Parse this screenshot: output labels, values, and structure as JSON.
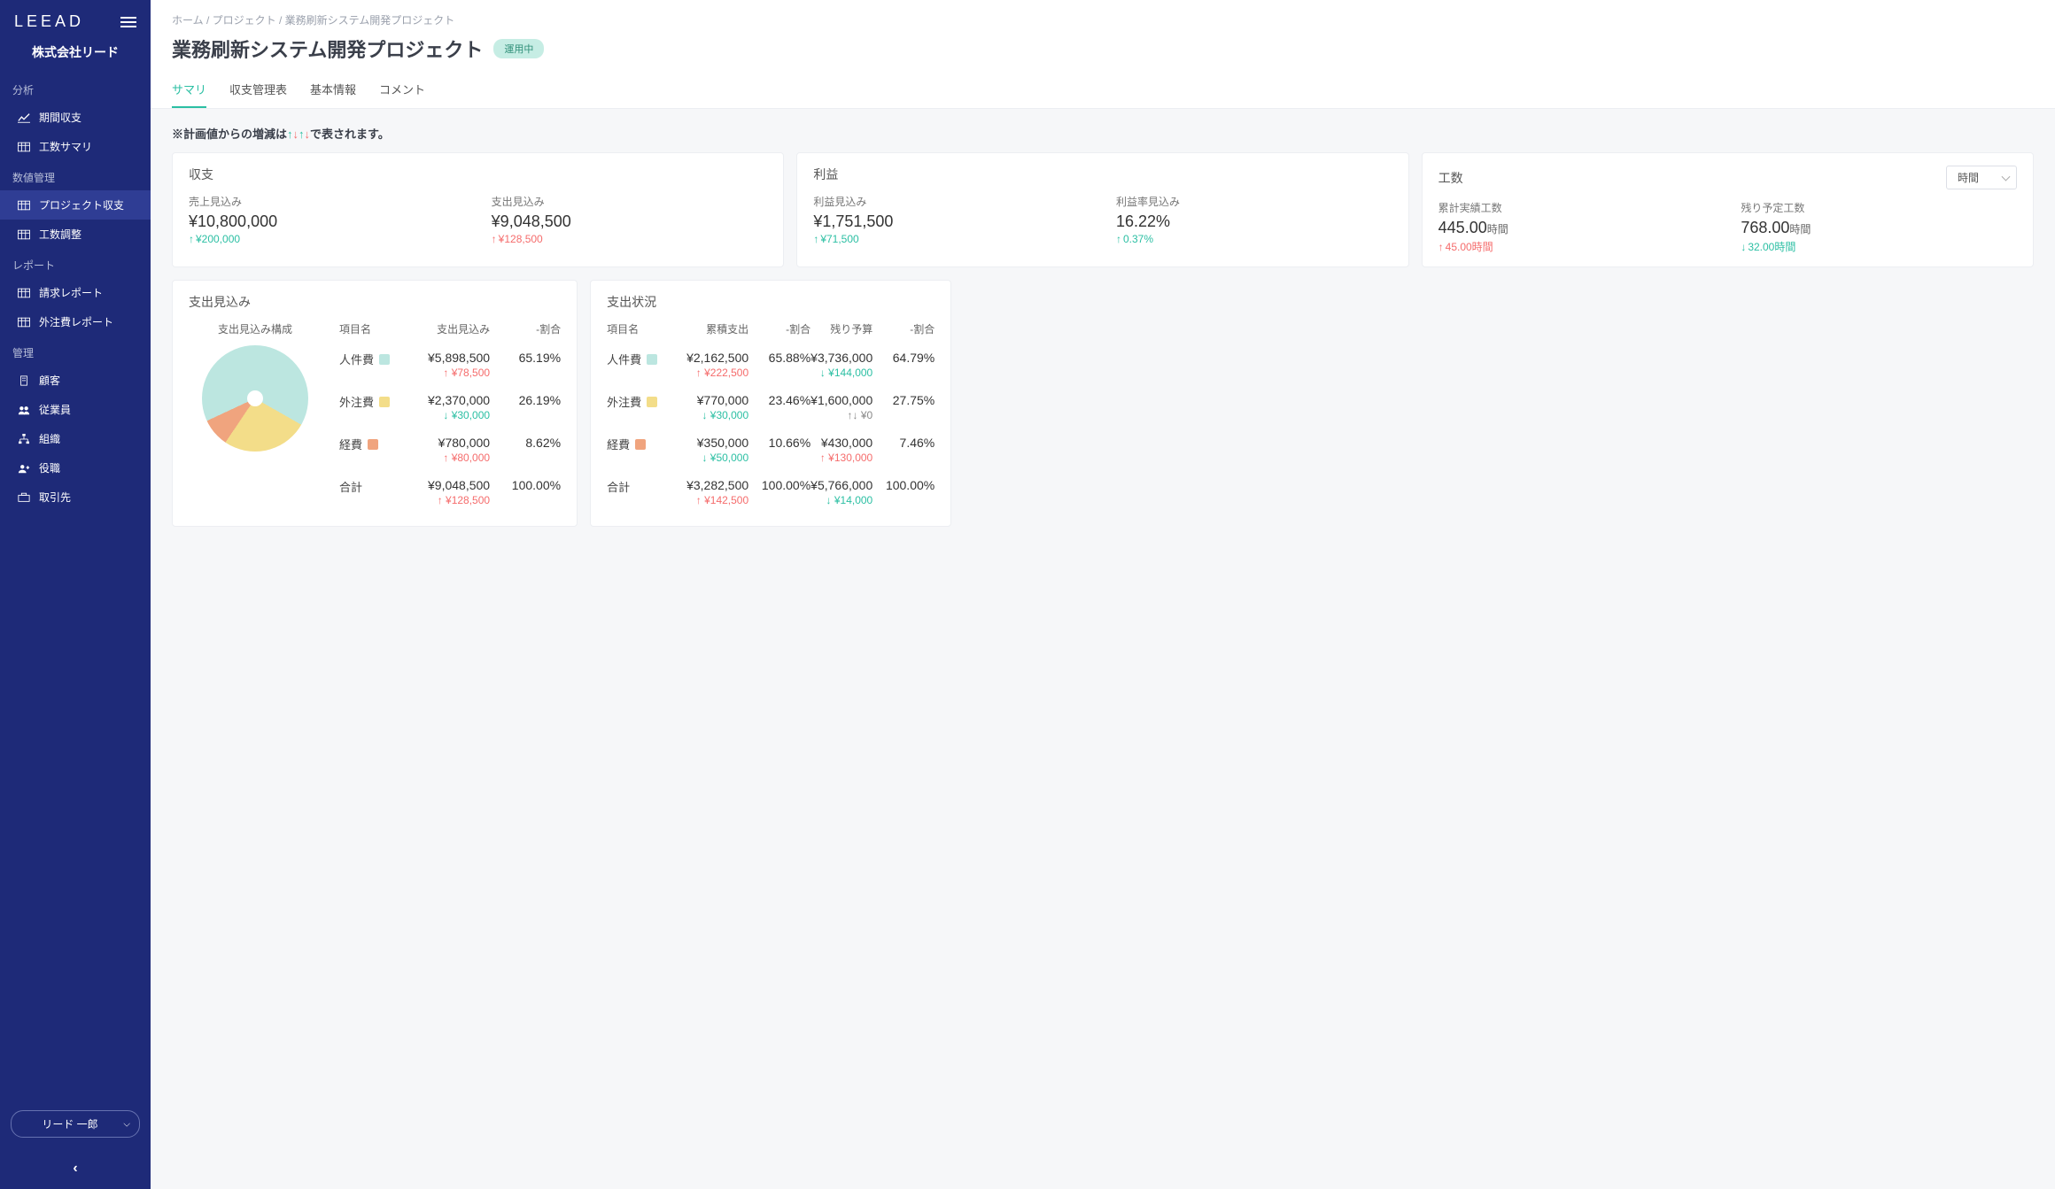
{
  "brand": "LEEAD",
  "company_name": "株式会社リード",
  "sidebar": {
    "sections": [
      {
        "title": "分析",
        "items": [
          {
            "icon": "chart-line",
            "label": "期間収支"
          },
          {
            "icon": "table",
            "label": "工数サマリ"
          }
        ]
      },
      {
        "title": "数値管理",
        "items": [
          {
            "icon": "table",
            "label": "プロジェクト収支",
            "active": true
          },
          {
            "icon": "table",
            "label": "工数調整"
          }
        ]
      },
      {
        "title": "レポート",
        "items": [
          {
            "icon": "table",
            "label": "請求レポート"
          },
          {
            "icon": "table",
            "label": "外注費レポート"
          }
        ]
      },
      {
        "title": "管理",
        "items": [
          {
            "icon": "building",
            "label": "顧客"
          },
          {
            "icon": "users",
            "label": "従業員"
          },
          {
            "icon": "sitemap",
            "label": "組織"
          },
          {
            "icon": "user-plus",
            "label": "役職"
          },
          {
            "icon": "briefcase",
            "label": "取引先"
          }
        ]
      }
    ],
    "user_label": "リード 一郎"
  },
  "breadcrumb": "ホーム / プロジェクト / 業務刷新システム開発プロジェクト",
  "page_title": "業務刷新システム開発プロジェクト",
  "status_badge": "運用中",
  "tabs": [
    "サマリ",
    "収支管理表",
    "基本情報",
    "コメント"
  ],
  "active_tab": 0,
  "note_prefix": "※計画値からの増減は",
  "note_suffix": "で表されます。",
  "summary_cards": {
    "shuushi": {
      "title": "収支",
      "metrics": [
        {
          "label": "売上見込み",
          "value": "¥10,800,000",
          "delta": "¥200,000",
          "dir": "up-good"
        },
        {
          "label": "支出見込み",
          "value": "¥9,048,500",
          "delta": "¥128,500",
          "dir": "up-bad"
        }
      ]
    },
    "rieki": {
      "title": "利益",
      "metrics": [
        {
          "label": "利益見込み",
          "value": "¥1,751,500",
          "delta": "¥71,500",
          "dir": "up-good"
        },
        {
          "label": "利益率見込み",
          "value": "16.22%",
          "delta": "0.37%",
          "dir": "up-good"
        }
      ]
    },
    "kousuu": {
      "title": "工数",
      "select": "時間",
      "metrics": [
        {
          "label": "累計実績工数",
          "value": "445.00",
          "unit": "時間",
          "delta": "45.00時間",
          "dir": "up-bad"
        },
        {
          "label": "残り予定工数",
          "value": "768.00",
          "unit": "時間",
          "delta": "32.00時間",
          "dir": "down-good"
        }
      ]
    }
  },
  "spending_forecast": {
    "title": "支出見込み",
    "pie_title": "支出見込み構成",
    "headers": {
      "name": "項目名",
      "value": "支出見込み",
      "pct": "-割合"
    },
    "rows": [
      {
        "name": "人件費",
        "color": "#bce6e0",
        "value": "¥5,898,500",
        "pct": "65.19%",
        "delta": "¥78,500",
        "dir": "up-bad"
      },
      {
        "name": "外注費",
        "color": "#f3dd89",
        "value": "¥2,370,000",
        "pct": "26.19%",
        "delta": "¥30,000",
        "dir": "down-good"
      },
      {
        "name": "経費",
        "color": "#f0a47e",
        "value": "¥780,000",
        "pct": "8.62%",
        "delta": "¥80,000",
        "dir": "up-bad"
      },
      {
        "name": "合計",
        "color": "",
        "value": "¥9,048,500",
        "pct": "100.00%",
        "delta": "¥128,500",
        "dir": "up-bad"
      }
    ]
  },
  "spending_status": {
    "title": "支出状況",
    "headers": {
      "name": "項目名",
      "cum": "累積支出",
      "cpct": "-割合",
      "rem": "残り予算",
      "rpct": "-割合"
    },
    "rows": [
      {
        "name": "人件費",
        "color": "#bce6e0",
        "cum": "¥2,162,500",
        "cpct": "65.88%",
        "cum_delta": "¥222,500",
        "cum_dir": "up-bad",
        "rem": "¥3,736,000",
        "rpct": "64.79%",
        "rem_delta": "¥144,000",
        "rem_dir": "down-good"
      },
      {
        "name": "外注費",
        "color": "#f3dd89",
        "cum": "¥770,000",
        "cpct": "23.46%",
        "cum_delta": "¥30,000",
        "cum_dir": "down-good",
        "rem": "¥1,600,000",
        "rpct": "27.75%",
        "rem_delta": "¥0",
        "rem_dir": "both"
      },
      {
        "name": "経費",
        "color": "#f0a47e",
        "cum": "¥350,000",
        "cpct": "10.66%",
        "cum_delta": "¥50,000",
        "cum_dir": "down-good",
        "rem": "¥430,000",
        "rpct": "7.46%",
        "rem_delta": "¥130,000",
        "rem_dir": "up-bad"
      },
      {
        "name": "合計",
        "color": "",
        "cum": "¥3,282,500",
        "cpct": "100.00%",
        "cum_delta": "¥142,500",
        "cum_dir": "up-bad",
        "rem": "¥5,766,000",
        "rpct": "100.00%",
        "rem_delta": "¥14,000",
        "rem_dir": "down-good"
      }
    ]
  },
  "chart_data": {
    "type": "pie",
    "title": "支出見込み構成",
    "categories": [
      "人件費",
      "外注費",
      "経費"
    ],
    "values": [
      65.19,
      26.19,
      8.62
    ],
    "colors": [
      "#bce6e0",
      "#f3dd89",
      "#f0a47e"
    ]
  }
}
